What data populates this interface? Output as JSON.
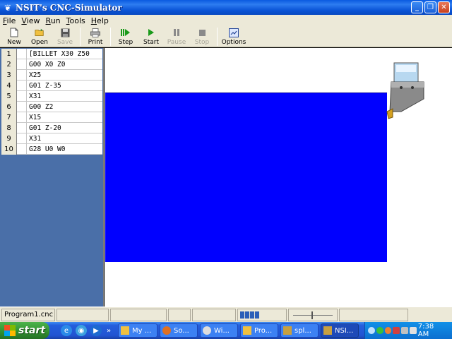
{
  "window": {
    "title": "NSIT's CNC-Simulator",
    "buttons": {
      "minimize": "_",
      "restore": "❐",
      "close": "✕"
    }
  },
  "menu": [
    "File",
    "View",
    "Run",
    "Tools",
    "Help"
  ],
  "toolbar": {
    "new": "New",
    "open": "Open",
    "save": "Save",
    "print": "Print",
    "step": "Step",
    "start": "Start",
    "pause": "Pause",
    "stop": "Stop",
    "options": "Options"
  },
  "program": {
    "lines": [
      {
        "num": "1",
        "code": "[BILLET X30 Z50"
      },
      {
        "num": "2",
        "code": "G00 X0 Z0"
      },
      {
        "num": "3",
        "code": "X25"
      },
      {
        "num": "4",
        "code": "G01 Z-35"
      },
      {
        "num": "5",
        "code": "X31"
      },
      {
        "num": "6",
        "code": "G00 Z2"
      },
      {
        "num": "7",
        "code": "X15"
      },
      {
        "num": "8",
        "code": "G01 Z-20"
      },
      {
        "num": "9",
        "code": "X31"
      },
      {
        "num": "10",
        "code": "G28 U0 W0"
      }
    ]
  },
  "colors": {
    "billet": "#0000ff",
    "code_panel_bg": "#4a6fa8",
    "title_bar": "#0a5ae0",
    "taskbar": "#245edc"
  },
  "status": {
    "file": "Program1.cnc"
  },
  "taskbar": {
    "start": "start",
    "chevron": "»",
    "tasks": [
      {
        "label": "My ...",
        "icon": "folder-icon"
      },
      {
        "label": "So...",
        "icon": "firefox-icon"
      },
      {
        "label": "Wi...",
        "icon": "media-icon"
      },
      {
        "label": "Pro...",
        "icon": "folder-icon"
      },
      {
        "label": "spl...",
        "icon": "app-icon"
      },
      {
        "label": "NSI...",
        "icon": "app-icon",
        "active": true
      }
    ],
    "clock": "7:38 AM"
  }
}
